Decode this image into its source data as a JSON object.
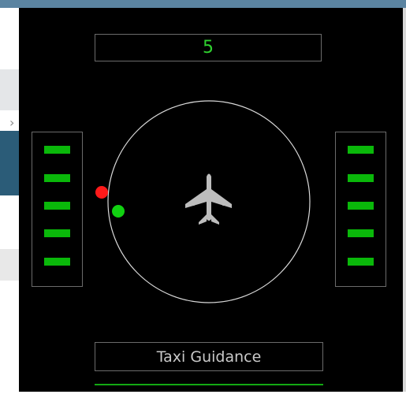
{
  "counter": {
    "value": "5"
  },
  "guidance": {
    "label": "Taxi Guidance"
  },
  "left_indicator": {
    "bars_lit": 5,
    "bars_total": 5
  },
  "right_indicator": {
    "bars_lit": 5,
    "bars_total": 5
  },
  "targets": [
    {
      "name": "red-target",
      "color": "#ff1a1a"
    },
    {
      "name": "green-target",
      "color": "#11d111"
    }
  ],
  "colors": {
    "panel_bg": "#000000",
    "accent_green": "#0ab80a",
    "counter_green": "#2fd12f",
    "ring": "#d9d9d9",
    "aircraft": "#bdbdbd"
  },
  "icons": {
    "aircraft": "airplane-icon"
  }
}
